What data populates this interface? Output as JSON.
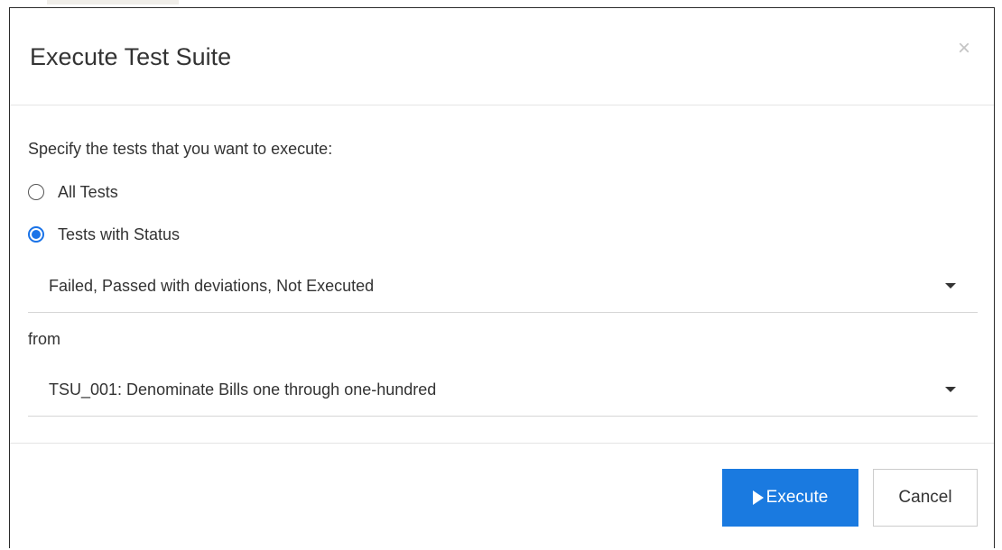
{
  "dialog": {
    "title": "Execute Test Suite",
    "close_glyph": "×"
  },
  "form": {
    "instructions": "Specify the tests that you want to execute:",
    "options": [
      {
        "label": "All Tests",
        "checked": false
      },
      {
        "label": "Tests with Status",
        "checked": true
      }
    ],
    "status_select": {
      "value": "Failed, Passed with deviations, Not Executed"
    },
    "from_label": "from",
    "suite_select": {
      "value": "TSU_001: Denominate Bills one through one-hundred"
    }
  },
  "footer": {
    "execute_label": "Execute",
    "cancel_label": "Cancel"
  },
  "colors": {
    "accent": "#1a7ae0",
    "radio_checked": "#1a73e8",
    "text": "#333333",
    "divider": "#e5e5e5"
  },
  "icons": {
    "close": "close-icon",
    "caret": "caret-down-icon",
    "play": "play-icon"
  }
}
